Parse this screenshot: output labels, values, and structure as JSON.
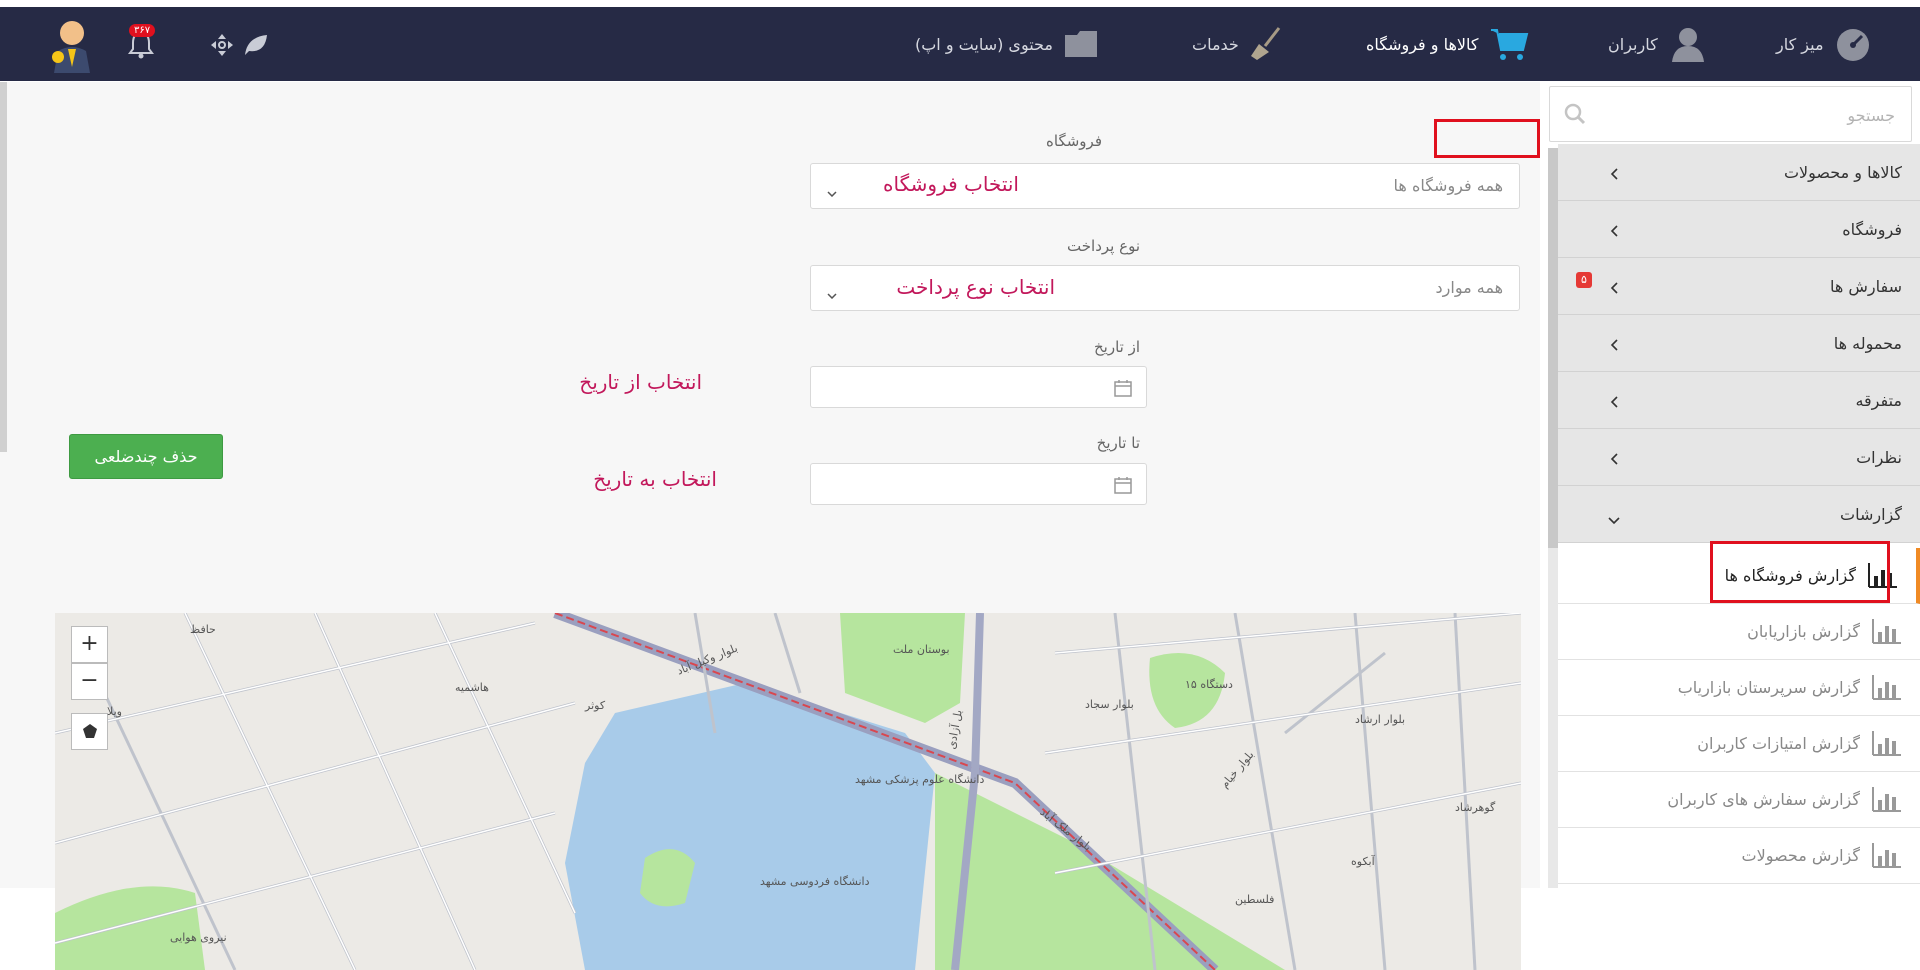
{
  "topbar": {
    "nav": [
      {
        "label": "میز کار",
        "icon": "dashboard-icon"
      },
      {
        "label": "کاربران",
        "icon": "user-icon"
      },
      {
        "label": "کالاها و فروشگاه",
        "icon": "cart-icon"
      },
      {
        "label": "خدمات",
        "icon": "broom-icon"
      },
      {
        "label": "محتوی (سایت و اپ)",
        "icon": "folder-icon"
      }
    ],
    "notification_count": "۳۶۷"
  },
  "sidebar": {
    "search_placeholder": "جستجو",
    "menu": [
      {
        "label": "کالاها و محصولات"
      },
      {
        "label": "فروشگاه"
      },
      {
        "label": "سفارش ها",
        "badge": "۵"
      },
      {
        "label": "محموله ها"
      },
      {
        "label": "متفرقه"
      },
      {
        "label": "نظرات"
      },
      {
        "label": "گزارشات"
      }
    ],
    "reports": [
      {
        "label": "گزارش فروشگاه ها"
      },
      {
        "label": "گزارش بازاریابان"
      },
      {
        "label": "گزارش سرپرستان بازاریاب"
      },
      {
        "label": "گزارش امتیازات کاربران"
      },
      {
        "label": "گزارش سفارش های کاربران"
      },
      {
        "label": "گزارش محصولات"
      }
    ]
  },
  "filters": {
    "store_label": "فروشگاه",
    "store_value": "همه فروشگاه ها",
    "store_annotation": "انتخاب فروشگاه",
    "payment_label": "نوع پرداخت",
    "payment_value": "همه موارد",
    "payment_annotation": "انتخاب نوع پرداخت",
    "from_label": "از تاریخ",
    "from_annotation": "انتخاب از تاریخ",
    "to_label": "تا تاریخ",
    "to_annotation": "انتخاب به تاریخ"
  },
  "actions": {
    "delete_polygon": "حذف چندضلعی"
  },
  "map": {
    "zoom_in": "+",
    "zoom_out": "−",
    "labels": {
      "university": "دانشگاه فردوسی مشهد",
      "medical_university": "دانشگاه علوم پزشکی مشهد",
      "mellat_park": "بوستان ملت",
      "hashemiyeh": "هاشمیه",
      "kowsar": "کوثر",
      "vakilabad": "بلوار وکیل آباد",
      "azadi": "بل آزادی",
      "sajjad": "بلوار سجاد",
      "hafez": "حافظ",
      "khayyam": "بلوار خیام",
      "ferdowsi": "بلوار فردوسی",
      "ershad": "بلوار ارشاد",
      "gohar": "گوهرشاد",
      "akoo": "آبکوه",
      "felestin": "فلسطین",
      "nirooye_havaei": "نیروی هوایی",
      "malekabad": "بلوار ملک آباد",
      "vila": "ویلا",
      "dastgah": "۱۵ دستگاه"
    }
  },
  "colors": {
    "topbar": "#262a45",
    "accent_green": "#4caf50",
    "annotation": "#c2185b",
    "highlight_frame": "#e0101e",
    "active_marker": "#f08a24"
  }
}
